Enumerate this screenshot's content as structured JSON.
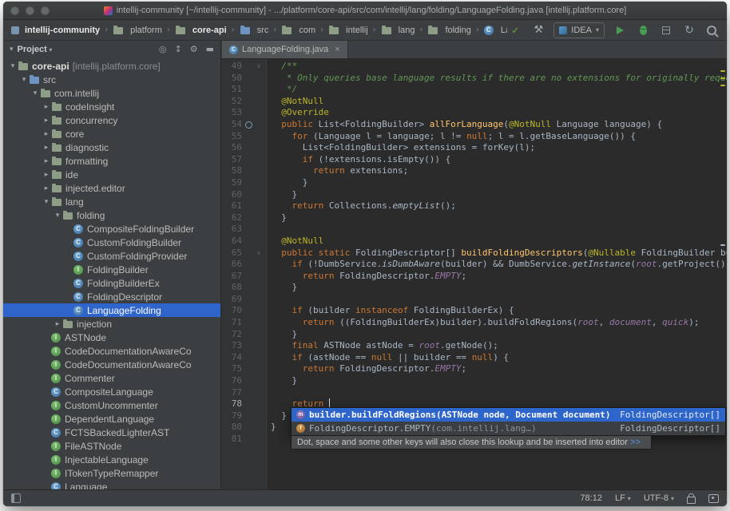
{
  "colors": {
    "panel_bg": "#3C3F41",
    "editor_bg": "#2B2B2B",
    "selection_blue": "#2F65CA",
    "keyword": "#CC7832",
    "annotation": "#BBB529",
    "javadoc": "#629755",
    "method_decl": "#FFC66D",
    "field_purple": "#9876AA",
    "run_green": "#499C54",
    "line_number": "#606366"
  },
  "titlebar": {
    "title": "intellij-community [~/intellij-community] - .../platform/core-api/src/com/intellij/lang/folding/LanguageFolding.java [intellij.platform.core]"
  },
  "navbar": {
    "separator": "›",
    "crumbs": [
      {
        "label": "intellij-community",
        "icon": "module",
        "bold": true
      },
      {
        "label": "platform",
        "icon": "folder"
      },
      {
        "label": "core-api",
        "icon": "folder",
        "bold": true
      },
      {
        "label": "src",
        "icon": "folder-src"
      },
      {
        "label": "com",
        "icon": "folder"
      },
      {
        "label": "intellij",
        "icon": "folder"
      },
      {
        "label": "lang",
        "icon": "folder"
      },
      {
        "label": "folding",
        "icon": "folder"
      },
      {
        "label": "LanguageFolding",
        "icon": "class"
      }
    ],
    "toolbar": [
      {
        "name": "inspect-code-icon",
        "glyph": "✓"
      },
      {
        "name": "build-hammer-icon",
        "glyph": "⚒"
      },
      {
        "name": "run-config-select",
        "type": "select",
        "label": "IDEA"
      },
      {
        "name": "run-button",
        "shape": "play"
      },
      {
        "name": "debug-button",
        "shape": "bug"
      },
      {
        "name": "coverage-button",
        "shape": "box"
      },
      {
        "name": "sync-icon",
        "glyph": "↻"
      },
      {
        "name": "search-everywhere-icon",
        "shape": "search"
      }
    ]
  },
  "project": {
    "title": "Project",
    "header_icons": [
      {
        "name": "locate-icon",
        "glyph": "◎"
      },
      {
        "name": "collapse-all-icon",
        "glyph": "↕"
      },
      {
        "name": "settings-gear-icon",
        "glyph": "⚙"
      },
      {
        "name": "hide-panel-icon",
        "glyph": "▬"
      }
    ],
    "tree": [
      {
        "label": "core-api",
        "suffix": " [intellij.platform.core]",
        "lvl": 0,
        "icon": "folder",
        "arrow": "d",
        "bold": true
      },
      {
        "label": "src",
        "lvl": 1,
        "icon": "folder-src",
        "arrow": "d"
      },
      {
        "label": "com.intellij",
        "lvl": 2,
        "icon": "package",
        "arrow": "d"
      },
      {
        "label": "codeInsight",
        "lvl": 3,
        "icon": "package",
        "arrow": "r"
      },
      {
        "label": "concurrency",
        "lvl": 3,
        "icon": "package",
        "arrow": "r"
      },
      {
        "label": "core",
        "lvl": 3,
        "icon": "package",
        "arrow": "r"
      },
      {
        "label": "diagnostic",
        "lvl": 3,
        "icon": "package",
        "arrow": "r"
      },
      {
        "label": "formatting",
        "lvl": 3,
        "icon": "package",
        "arrow": "r"
      },
      {
        "label": "ide",
        "lvl": 3,
        "icon": "package",
        "arrow": "r"
      },
      {
        "label": "injected.editor",
        "lvl": 3,
        "icon": "package",
        "arrow": "r"
      },
      {
        "label": "lang",
        "lvl": 3,
        "icon": "package",
        "arrow": "d"
      },
      {
        "label": "folding",
        "lvl": 4,
        "icon": "package",
        "arrow": "d"
      },
      {
        "label": "CompositeFoldingBuilder",
        "lvl": 5,
        "icon": "class"
      },
      {
        "label": "CustomFoldingBuilder",
        "lvl": 5,
        "icon": "class"
      },
      {
        "label": "CustomFoldingProvider",
        "lvl": 5,
        "icon": "class"
      },
      {
        "label": "FoldingBuilder",
        "lvl": 5,
        "icon": "interface"
      },
      {
        "label": "FoldingBuilderEx",
        "lvl": 5,
        "icon": "class"
      },
      {
        "label": "FoldingDescriptor",
        "lvl": 5,
        "icon": "class"
      },
      {
        "label": "LanguageFolding",
        "lvl": 5,
        "icon": "class",
        "selected": true
      },
      {
        "label": "injection",
        "lvl": 4,
        "icon": "package",
        "arrow": "r"
      },
      {
        "label": "ASTNode",
        "lvl": 3,
        "icon": "interface"
      },
      {
        "label": "CodeDocumentationAwareCo",
        "lvl": 3,
        "icon": "interface"
      },
      {
        "label": "CodeDocumentationAwareCo",
        "lvl": 3,
        "icon": "interface"
      },
      {
        "label": "Commenter",
        "lvl": 3,
        "icon": "interface"
      },
      {
        "label": "CompositeLanguage",
        "lvl": 3,
        "icon": "class"
      },
      {
        "label": "CustomUncommenter",
        "lvl": 3,
        "icon": "interface"
      },
      {
        "label": "DependentLanguage",
        "lvl": 3,
        "icon": "interface"
      },
      {
        "label": "FCTSBackedLighterAST",
        "lvl": 3,
        "icon": "class"
      },
      {
        "label": "FileASTNode",
        "lvl": 3,
        "icon": "interface"
      },
      {
        "label": "InjectableLanguage",
        "lvl": 3,
        "icon": "interface"
      },
      {
        "label": "ITokenTypeRemapper",
        "lvl": 3,
        "icon": "interface"
      },
      {
        "label": "Language",
        "lvl": 3,
        "icon": "class"
      }
    ]
  },
  "editor": {
    "tab": {
      "label": "LanguageFolding.java",
      "close": "×",
      "icon_letter": "C"
    },
    "stripe": [
      {
        "t": 14,
        "c": "#BBB529"
      },
      {
        "t": 23,
        "c": "#BBB529"
      },
      {
        "t": 32,
        "c": "#BBB529"
      },
      {
        "t": 232,
        "c": "#A9B7C6"
      }
    ],
    "lines": [
      {
        "n": 49,
        "seg": [
          [
            "  /**",
            "doc"
          ]
        ],
        "f": 1
      },
      {
        "n": 50,
        "seg": [
          [
            "   * Only queries base language results if there are no extensions for originally requested",
            "doc"
          ]
        ]
      },
      {
        "n": 51,
        "seg": [
          [
            "   */",
            "doc"
          ]
        ]
      },
      {
        "n": 52,
        "seg": [
          [
            "  @NotNull",
            "ann"
          ]
        ]
      },
      {
        "n": 53,
        "seg": [
          [
            "  @Override",
            "ann"
          ]
        ]
      },
      {
        "n": 54,
        "seg": [
          [
            "  ",
            "pln"
          ],
          [
            "public ",
            "kw"
          ],
          [
            "List<FoldingBuilder> ",
            "pln"
          ],
          [
            "allForLanguage",
            "mdecl"
          ],
          [
            "(",
            "pln"
          ],
          [
            "@NotNull",
            "ann"
          ],
          [
            " Language language) {",
            "pln"
          ]
        ],
        "g": "override"
      },
      {
        "n": 55,
        "seg": [
          [
            "    ",
            "pln"
          ],
          [
            "for",
            "kw"
          ],
          [
            " (Language l = language; l != ",
            "pln"
          ],
          [
            "null",
            "kw"
          ],
          [
            "; l = l.getBaseLanguage()) {",
            "pln"
          ]
        ]
      },
      {
        "n": 56,
        "seg": [
          [
            "      List<FoldingBuilder> extensions = forKey(l);",
            "pln"
          ]
        ]
      },
      {
        "n": 57,
        "seg": [
          [
            "      ",
            "pln"
          ],
          [
            "if",
            "kw"
          ],
          [
            " (!extensions.isEmpty()) {",
            "pln"
          ]
        ]
      },
      {
        "n": 58,
        "seg": [
          [
            "        ",
            "pln"
          ],
          [
            "return",
            "kw"
          ],
          [
            " extensions;",
            "pln"
          ]
        ]
      },
      {
        "n": 59,
        "seg": [
          [
            "      }",
            "pln"
          ]
        ]
      },
      {
        "n": 60,
        "seg": [
          [
            "    }",
            "pln"
          ]
        ]
      },
      {
        "n": 61,
        "seg": [
          [
            "    ",
            "pln"
          ],
          [
            "return",
            "kw"
          ],
          [
            " Collections.",
            "pln"
          ],
          [
            "emptyList",
            "stc"
          ],
          [
            "();",
            "pln"
          ]
        ]
      },
      {
        "n": 62,
        "seg": [
          [
            "  }",
            "pln"
          ]
        ]
      },
      {
        "n": 63,
        "seg": []
      },
      {
        "n": 64,
        "seg": [
          [
            "  @NotNull",
            "ann"
          ]
        ]
      },
      {
        "n": 65,
        "seg": [
          [
            "  ",
            "pln"
          ],
          [
            "public static ",
            "kw"
          ],
          [
            "FoldingDescriptor[] ",
            "pln"
          ],
          [
            "buildFoldingDescriptors",
            "mdecl"
          ],
          [
            "(",
            "pln"
          ],
          [
            "@Nullable",
            "ann"
          ],
          [
            " FoldingBuilder builder",
            "pln"
          ]
        ],
        "f": 1
      },
      {
        "n": 66,
        "seg": [
          [
            "    ",
            "pln"
          ],
          [
            "if",
            "kw"
          ],
          [
            " (!DumbService.",
            "pln"
          ],
          [
            "isDumbAware",
            "stc"
          ],
          [
            "(builder) && DumbService.",
            "pln"
          ],
          [
            "getInstance",
            "stc"
          ],
          [
            "(",
            "pln"
          ],
          [
            "root",
            "fld"
          ],
          [
            ".getProject()).isDu",
            "pln"
          ]
        ]
      },
      {
        "n": 67,
        "seg": [
          [
            "      ",
            "pln"
          ],
          [
            "return",
            "kw"
          ],
          [
            " FoldingDescriptor.",
            "pln"
          ],
          [
            "EMPTY",
            "fld"
          ],
          [
            ";",
            "pln"
          ]
        ]
      },
      {
        "n": 68,
        "seg": [
          [
            "    }",
            "pln"
          ]
        ]
      },
      {
        "n": 69,
        "seg": []
      },
      {
        "n": 70,
        "seg": [
          [
            "    ",
            "pln"
          ],
          [
            "if",
            "kw"
          ],
          [
            " (builder ",
            "pln"
          ],
          [
            "instanceof",
            "kw"
          ],
          [
            " FoldingBuilderEx) {",
            "pln"
          ]
        ]
      },
      {
        "n": 71,
        "seg": [
          [
            "      ",
            "pln"
          ],
          [
            "return",
            "kw"
          ],
          [
            " ((FoldingBuilderEx)builder).buildFoldRegions(",
            "pln"
          ],
          [
            "root",
            "fld"
          ],
          [
            ", ",
            "pln"
          ],
          [
            "document",
            "fld"
          ],
          [
            ", ",
            "pln"
          ],
          [
            "quick",
            "fld"
          ],
          [
            ");",
            "pln"
          ]
        ]
      },
      {
        "n": 72,
        "seg": [
          [
            "    }",
            "pln"
          ]
        ]
      },
      {
        "n": 73,
        "seg": [
          [
            "    ",
            "pln"
          ],
          [
            "final",
            "kw"
          ],
          [
            " ASTNode astNode = ",
            "pln"
          ],
          [
            "root",
            "fld"
          ],
          [
            ".getNode();",
            "pln"
          ]
        ]
      },
      {
        "n": 74,
        "seg": [
          [
            "    ",
            "pln"
          ],
          [
            "if",
            "kw"
          ],
          [
            " (astNode == ",
            "pln"
          ],
          [
            "null",
            "kw"
          ],
          [
            " || builder == ",
            "pln"
          ],
          [
            "null",
            "kw"
          ],
          [
            ") {",
            "pln"
          ]
        ]
      },
      {
        "n": 75,
        "seg": [
          [
            "      ",
            "pln"
          ],
          [
            "return",
            "kw"
          ],
          [
            " FoldingDescriptor.",
            "pln"
          ],
          [
            "EMPTY",
            "fld"
          ],
          [
            ";",
            "pln"
          ]
        ]
      },
      {
        "n": 76,
        "seg": [
          [
            "    }",
            "pln"
          ]
        ]
      },
      {
        "n": 77,
        "seg": []
      },
      {
        "n": 78,
        "seg": [
          [
            "    ",
            "pln"
          ],
          [
            "return",
            "kw"
          ],
          [
            " ",
            "pln"
          ]
        ],
        "caret": true,
        "cur": true
      },
      {
        "n": 79,
        "seg": [
          [
            "  }",
            "pln"
          ]
        ]
      },
      {
        "n": 80,
        "seg": [
          [
            "}",
            "pln"
          ]
        ]
      },
      {
        "n": 81,
        "seg": []
      }
    ]
  },
  "popup": {
    "rows": [
      {
        "icon": "method",
        "text": "builder.buildFoldRegions(ASTNode node, Document document)",
        "type": "FoldingDescriptor[]",
        "selected": true
      },
      {
        "icon": "field",
        "text": "FoldingDescriptor.EMPTY",
        "note": " (com.intellij.lang…)",
        "type": "FoldingDescriptor[]"
      }
    ],
    "hint": {
      "text": "Dot, space and some other keys will also close this lookup and be inserted into editor",
      "link": ">>"
    }
  },
  "statusbar": {
    "position": "78:12",
    "line_sep": "LF",
    "encoding": "UTF-8"
  }
}
